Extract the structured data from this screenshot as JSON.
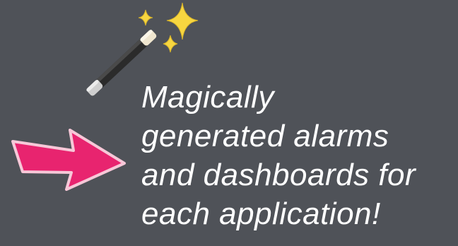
{
  "icons": {
    "wand": "magic-wand-icon",
    "arrow": "right-arrow-icon"
  },
  "colors": {
    "background": "#4f5258",
    "text": "#ffffff",
    "arrow": "#e8246f",
    "sparkle": "#f7d640"
  },
  "caption": {
    "lines": [
      "Magically",
      "generated alarms",
      "and dashboards for",
      "each application!"
    ]
  }
}
